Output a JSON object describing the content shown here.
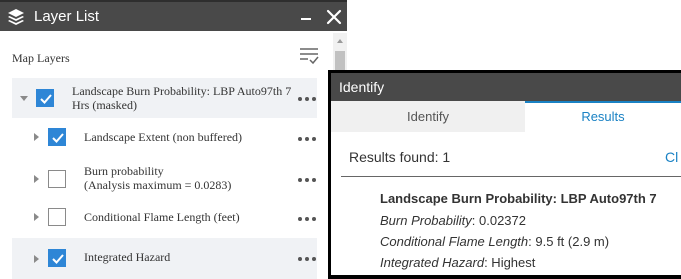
{
  "layer_list": {
    "title": "Layer List",
    "section_label": "Map Layers",
    "layers": [
      {
        "label_line1": "Landscape Burn Probability: LBP Auto97th 7",
        "label_line2": "Hrs (masked)",
        "checked": true,
        "expanded": true
      },
      {
        "label_line1": "Landscape Extent (non buffered)",
        "checked": true
      },
      {
        "label_line1": "Burn probability",
        "label_line2": "(Analysis maximum = 0.0283)",
        "checked": false
      },
      {
        "label_line1": "Conditional Flame Length (feet)",
        "checked": false
      },
      {
        "label_line1": "Integrated Hazard",
        "checked": true
      }
    ]
  },
  "identify": {
    "title": "Identify",
    "tabs": [
      "Identify",
      "Results"
    ],
    "active_tab": "Results",
    "results_found": "Results found: 1",
    "clear_link": "Cl",
    "result": {
      "layer_title": "Landscape Burn Probability: LBP Auto97th 7",
      "fields": [
        {
          "name": "Burn Probability",
          "value": ": 0.02372"
        },
        {
          "name": "Conditional Flame Length",
          "value": ": 9.5 ft (2.9 m)"
        },
        {
          "name": "Integrated Hazard",
          "value": ": Highest"
        }
      ]
    }
  },
  "colors": {
    "header_bg": "#494949",
    "checkbox_checked": "#2e86d6",
    "accent_link": "#1a82c4",
    "row_shade": "#f0f2f5"
  },
  "icons": [
    "layers-icon",
    "minimize-icon",
    "close-icon",
    "list-options-icon",
    "expand-arrow-icon",
    "more-options-icon"
  ]
}
